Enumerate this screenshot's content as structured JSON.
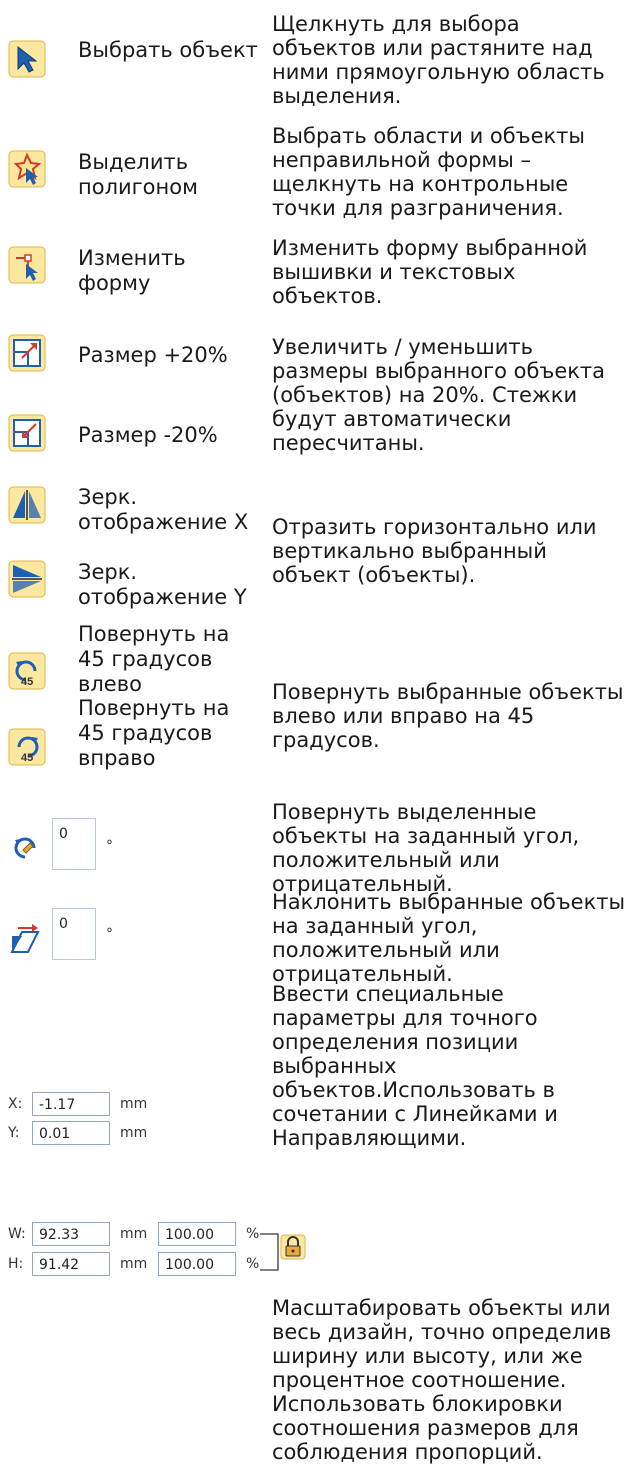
{
  "rows": [
    {
      "label": "Выбрать объект",
      "desc": "Щелкнуть для выбора объектов или растяните над ними прямоугольную область выделения.",
      "icon": "select-arrow-icon"
    },
    {
      "label": "Выделить полигоном",
      "desc": "Выбрать области и объекты неправильной формы – щелкнуть на контрольные точки для разграничения.",
      "icon": "polygon-select-icon"
    },
    {
      "label": "Изменить форму",
      "desc": "Изменить форму выбранной вышивки и текстовых объектов.",
      "icon": "reshape-icon"
    },
    {
      "label": "Размер +20%",
      "icon": "scale-up-icon"
    },
    {
      "label": "Размер -20%",
      "icon": "scale-down-icon"
    },
    {
      "desc": "Увеличить / уменьшить размеры выбранного объекта (объектов) на 20%. Стежки будут автоматически пересчитаны."
    },
    {
      "label": "Зерк. отображение X",
      "icon": "mirror-x-icon"
    },
    {
      "label": "Зерк. отображение Y",
      "icon": "mirror-y-icon"
    },
    {
      "desc": "Отразить горизонтально или вертикально выбранный объект (объекты)."
    },
    {
      "label": "Повернуть на 45 градусов влево",
      "icon": "rotate-left-45-icon"
    },
    {
      "label": "Повернуть на 45 градусов вправо",
      "icon": "rotate-right-45-icon"
    },
    {
      "desc": "Повернуть выбранные объекты влево или вправо на 45 градусов."
    }
  ],
  "rotate_control": {
    "value": "0",
    "unit": "°",
    "desc": "Повернуть выделенные объекты на заданный угол, положительный или отрицательный."
  },
  "skew_control": {
    "value": "0",
    "unit": "°",
    "desc": "Наклонить выбранные объекты на заданный угол, положительный или отрицательный."
  },
  "position_control": {
    "x_label": "X:",
    "x_value": "-1.17",
    "y_label": "Y:",
    "y_value": "0.01",
    "unit": "mm",
    "desc": "Ввести специальные параметры для точного определения позиции выбранных объектов.Использовать в сочетании с Линейками и Направляющими."
  },
  "size_control": {
    "w_label": "W:",
    "w_value": "92.33",
    "w_unit": "mm",
    "w_percent": "100.00",
    "h_label": "H:",
    "h_value": "91.42",
    "h_unit": "mm",
    "h_percent": "100.00",
    "percent_sign": "%",
    "lock_icon": "lock-icon",
    "desc": "Масштабировать объекты или весь дизайн, точно определив ширину или высоту, или же процентное соотношение. Использовать блокировки соотношения размеров для соблюдения пропорций."
  },
  "colors": {
    "icon_bg": "#fbe7a0",
    "icon_border": "#e0b44a",
    "accent_blue": "#1f5fb0",
    "accent_red": "#d23a2a"
  }
}
